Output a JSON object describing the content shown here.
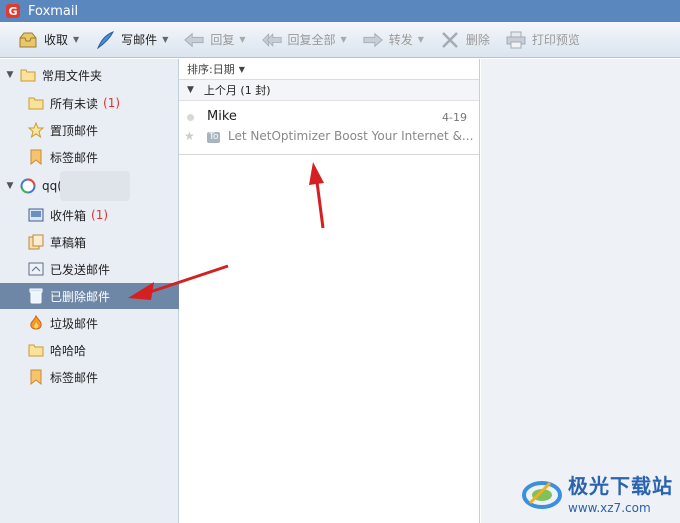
{
  "app": {
    "title": "Foxmail",
    "logo_letter": "G"
  },
  "toolbar": {
    "receive": "收取",
    "compose": "写邮件",
    "reply": "回复",
    "reply_all": "回复全部",
    "forward": "转发",
    "delete": "删除",
    "print_preview": "打印预览"
  },
  "sidebar": {
    "common_folder": {
      "label": "常用文件夹",
      "items": [
        {
          "label": "所有未读",
          "count": "(1)"
        },
        {
          "label": "置顶邮件"
        },
        {
          "label": "标签邮件"
        }
      ]
    },
    "account": {
      "label": "qq(2",
      "items": [
        {
          "label": "收件箱",
          "count": "(1)"
        },
        {
          "label": "草稿箱"
        },
        {
          "label": "已发送邮件"
        },
        {
          "label": "已删除邮件"
        },
        {
          "label": "垃圾邮件"
        },
        {
          "label": "哈哈哈"
        },
        {
          "label": "标签邮件"
        }
      ]
    }
  },
  "list": {
    "sort_label": "排序:日期",
    "group_label": "上个月 (1 封)",
    "emails": [
      {
        "sender": "Mike",
        "date": "4-19",
        "to_tag": "To",
        "subject": "Let NetOptimizer Boost Your Internet &..."
      }
    ]
  },
  "watermark": {
    "main": "极光下载站",
    "url": "www.xz7.com"
  },
  "colors": {
    "titlebar": "#5b87bf",
    "selected": "#6f87a6",
    "unread_count": "#d33333",
    "arrow": "#d42020"
  }
}
